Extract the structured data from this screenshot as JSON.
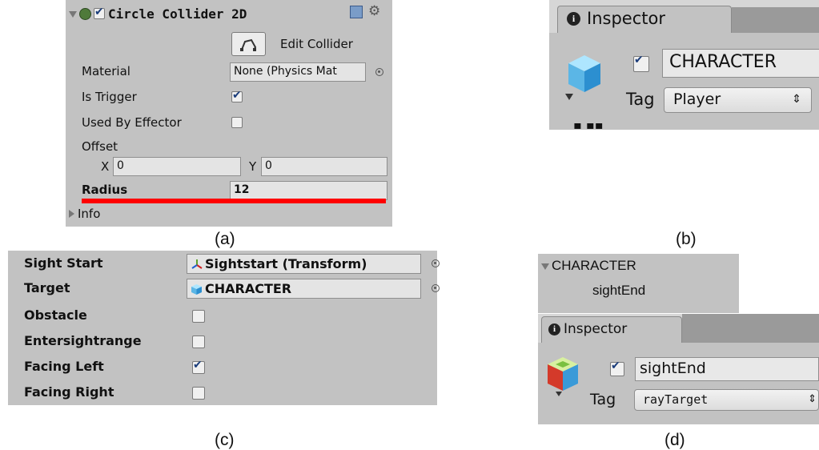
{
  "panel_a": {
    "component_title": "Circle Collider 2D",
    "edit_collider_label": "Edit Collider",
    "material_label": "Material",
    "material_value": "None (Physics Mat",
    "is_trigger_label": "Is Trigger",
    "is_trigger_checked": true,
    "used_by_effector_label": "Used By Effector",
    "used_by_effector_checked": false,
    "offset_label": "Offset",
    "offset_x_label": "X",
    "offset_x_value": "0",
    "offset_y_label": "Y",
    "offset_y_value": "0",
    "radius_label": "Radius",
    "radius_value": "12",
    "info_label": "Info",
    "underline_color": "#ff0000"
  },
  "panel_b": {
    "tab_label": "Inspector",
    "object_active": true,
    "object_name": "CHARACTER",
    "tag_label": "Tag",
    "tag_value": "Player"
  },
  "panel_c": {
    "sight_start_label": "Sight Start",
    "sight_start_value": "Sightstart (Transform)",
    "target_label": "Target",
    "target_value": "CHARACTER",
    "obstacle_label": "Obstacle",
    "obstacle_checked": false,
    "entersightrange_label": "Entersightrange",
    "entersightrange_checked": false,
    "facing_left_label": "Facing Left",
    "facing_left_checked": true,
    "facing_right_label": "Facing Right",
    "facing_right_checked": false
  },
  "panel_d": {
    "hierarchy_parent": "CHARACTER",
    "hierarchy_child": "sightEnd",
    "tab_label": "Inspector",
    "object_active": true,
    "object_name": "sightEnd",
    "tag_label": "Tag",
    "tag_value": "rayTarget"
  },
  "captions": {
    "a": "(a)",
    "b": "(b)",
    "c": "(c)",
    "d": "(d)"
  }
}
